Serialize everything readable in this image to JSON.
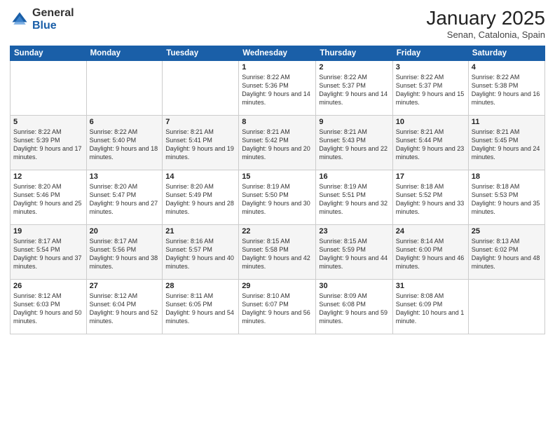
{
  "logo": {
    "general": "General",
    "blue": "Blue"
  },
  "header": {
    "month": "January 2025",
    "location": "Senan, Catalonia, Spain"
  },
  "weekdays": [
    "Sunday",
    "Monday",
    "Tuesday",
    "Wednesday",
    "Thursday",
    "Friday",
    "Saturday"
  ],
  "weeks": [
    [
      {
        "day": "",
        "sunrise": "",
        "sunset": "",
        "daylight": ""
      },
      {
        "day": "",
        "sunrise": "",
        "sunset": "",
        "daylight": ""
      },
      {
        "day": "",
        "sunrise": "",
        "sunset": "",
        "daylight": ""
      },
      {
        "day": "1",
        "sunrise": "Sunrise: 8:22 AM",
        "sunset": "Sunset: 5:36 PM",
        "daylight": "Daylight: 9 hours and 14 minutes."
      },
      {
        "day": "2",
        "sunrise": "Sunrise: 8:22 AM",
        "sunset": "Sunset: 5:37 PM",
        "daylight": "Daylight: 9 hours and 14 minutes."
      },
      {
        "day": "3",
        "sunrise": "Sunrise: 8:22 AM",
        "sunset": "Sunset: 5:37 PM",
        "daylight": "Daylight: 9 hours and 15 minutes."
      },
      {
        "day": "4",
        "sunrise": "Sunrise: 8:22 AM",
        "sunset": "Sunset: 5:38 PM",
        "daylight": "Daylight: 9 hours and 16 minutes."
      }
    ],
    [
      {
        "day": "5",
        "sunrise": "Sunrise: 8:22 AM",
        "sunset": "Sunset: 5:39 PM",
        "daylight": "Daylight: 9 hours and 17 minutes."
      },
      {
        "day": "6",
        "sunrise": "Sunrise: 8:22 AM",
        "sunset": "Sunset: 5:40 PM",
        "daylight": "Daylight: 9 hours and 18 minutes."
      },
      {
        "day": "7",
        "sunrise": "Sunrise: 8:21 AM",
        "sunset": "Sunset: 5:41 PM",
        "daylight": "Daylight: 9 hours and 19 minutes."
      },
      {
        "day": "8",
        "sunrise": "Sunrise: 8:21 AM",
        "sunset": "Sunset: 5:42 PM",
        "daylight": "Daylight: 9 hours and 20 minutes."
      },
      {
        "day": "9",
        "sunrise": "Sunrise: 8:21 AM",
        "sunset": "Sunset: 5:43 PM",
        "daylight": "Daylight: 9 hours and 22 minutes."
      },
      {
        "day": "10",
        "sunrise": "Sunrise: 8:21 AM",
        "sunset": "Sunset: 5:44 PM",
        "daylight": "Daylight: 9 hours and 23 minutes."
      },
      {
        "day": "11",
        "sunrise": "Sunrise: 8:21 AM",
        "sunset": "Sunset: 5:45 PM",
        "daylight": "Daylight: 9 hours and 24 minutes."
      }
    ],
    [
      {
        "day": "12",
        "sunrise": "Sunrise: 8:20 AM",
        "sunset": "Sunset: 5:46 PM",
        "daylight": "Daylight: 9 hours and 25 minutes."
      },
      {
        "day": "13",
        "sunrise": "Sunrise: 8:20 AM",
        "sunset": "Sunset: 5:47 PM",
        "daylight": "Daylight: 9 hours and 27 minutes."
      },
      {
        "day": "14",
        "sunrise": "Sunrise: 8:20 AM",
        "sunset": "Sunset: 5:49 PM",
        "daylight": "Daylight: 9 hours and 28 minutes."
      },
      {
        "day": "15",
        "sunrise": "Sunrise: 8:19 AM",
        "sunset": "Sunset: 5:50 PM",
        "daylight": "Daylight: 9 hours and 30 minutes."
      },
      {
        "day": "16",
        "sunrise": "Sunrise: 8:19 AM",
        "sunset": "Sunset: 5:51 PM",
        "daylight": "Daylight: 9 hours and 32 minutes."
      },
      {
        "day": "17",
        "sunrise": "Sunrise: 8:18 AM",
        "sunset": "Sunset: 5:52 PM",
        "daylight": "Daylight: 9 hours and 33 minutes."
      },
      {
        "day": "18",
        "sunrise": "Sunrise: 8:18 AM",
        "sunset": "Sunset: 5:53 PM",
        "daylight": "Daylight: 9 hours and 35 minutes."
      }
    ],
    [
      {
        "day": "19",
        "sunrise": "Sunrise: 8:17 AM",
        "sunset": "Sunset: 5:54 PM",
        "daylight": "Daylight: 9 hours and 37 minutes."
      },
      {
        "day": "20",
        "sunrise": "Sunrise: 8:17 AM",
        "sunset": "Sunset: 5:56 PM",
        "daylight": "Daylight: 9 hours and 38 minutes."
      },
      {
        "day": "21",
        "sunrise": "Sunrise: 8:16 AM",
        "sunset": "Sunset: 5:57 PM",
        "daylight": "Daylight: 9 hours and 40 minutes."
      },
      {
        "day": "22",
        "sunrise": "Sunrise: 8:15 AM",
        "sunset": "Sunset: 5:58 PM",
        "daylight": "Daylight: 9 hours and 42 minutes."
      },
      {
        "day": "23",
        "sunrise": "Sunrise: 8:15 AM",
        "sunset": "Sunset: 5:59 PM",
        "daylight": "Daylight: 9 hours and 44 minutes."
      },
      {
        "day": "24",
        "sunrise": "Sunrise: 8:14 AM",
        "sunset": "Sunset: 6:00 PM",
        "daylight": "Daylight: 9 hours and 46 minutes."
      },
      {
        "day": "25",
        "sunrise": "Sunrise: 8:13 AM",
        "sunset": "Sunset: 6:02 PM",
        "daylight": "Daylight: 9 hours and 48 minutes."
      }
    ],
    [
      {
        "day": "26",
        "sunrise": "Sunrise: 8:12 AM",
        "sunset": "Sunset: 6:03 PM",
        "daylight": "Daylight: 9 hours and 50 minutes."
      },
      {
        "day": "27",
        "sunrise": "Sunrise: 8:12 AM",
        "sunset": "Sunset: 6:04 PM",
        "daylight": "Daylight: 9 hours and 52 minutes."
      },
      {
        "day": "28",
        "sunrise": "Sunrise: 8:11 AM",
        "sunset": "Sunset: 6:05 PM",
        "daylight": "Daylight: 9 hours and 54 minutes."
      },
      {
        "day": "29",
        "sunrise": "Sunrise: 8:10 AM",
        "sunset": "Sunset: 6:07 PM",
        "daylight": "Daylight: 9 hours and 56 minutes."
      },
      {
        "day": "30",
        "sunrise": "Sunrise: 8:09 AM",
        "sunset": "Sunset: 6:08 PM",
        "daylight": "Daylight: 9 hours and 59 minutes."
      },
      {
        "day": "31",
        "sunrise": "Sunrise: 8:08 AM",
        "sunset": "Sunset: 6:09 PM",
        "daylight": "Daylight: 10 hours and 1 minute."
      },
      {
        "day": "",
        "sunrise": "",
        "sunset": "",
        "daylight": ""
      }
    ]
  ]
}
